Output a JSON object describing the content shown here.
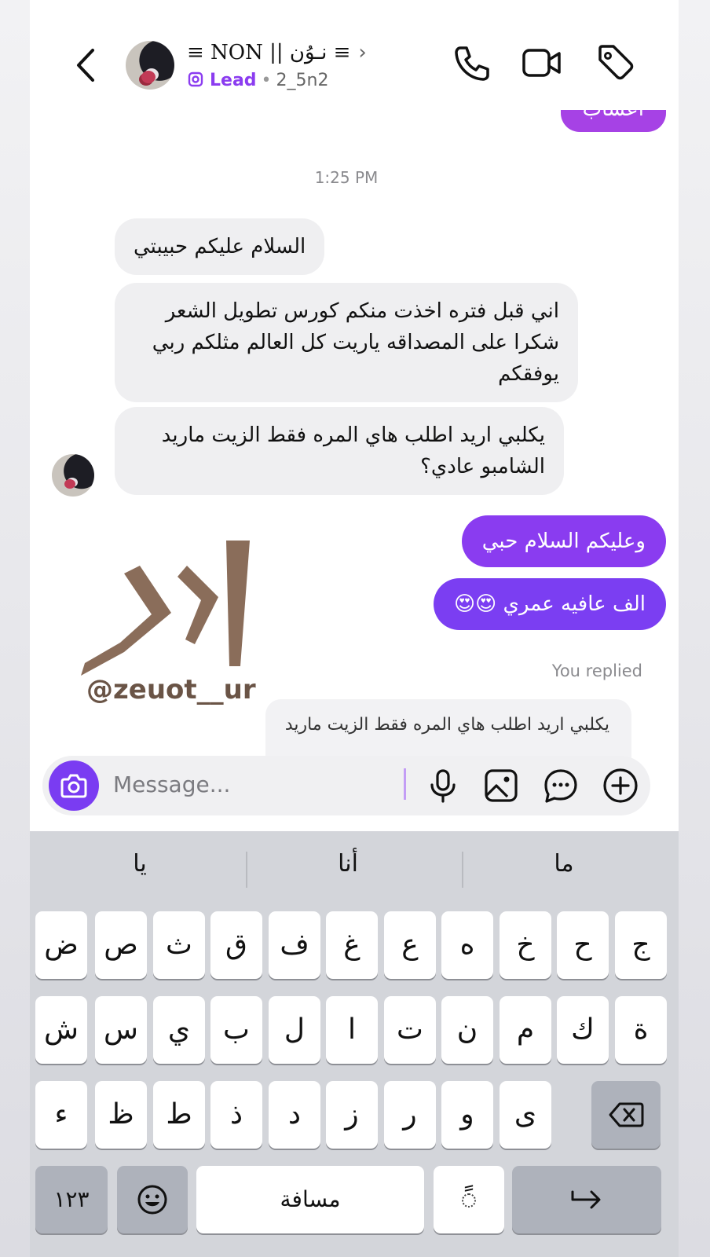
{
  "header": {
    "contact_name": "≡ NON || نـوُن ≡",
    "chevron": "›",
    "lead_label": "Lead",
    "separator": "•",
    "username": "2_5n2"
  },
  "chat": {
    "prev_outgoing_partial": "اعشاب",
    "timestamp": "1:25 PM",
    "incoming": [
      "السلام عليكم حبيبتي",
      "اني قبل فتره اخذت منكم كورس تطويل الشعر شكرا على المصداقه ياريت كل العالم مثلكم ربي يوفقكم",
      "يكلبي اريد اطلب هاي المره فقط الزيت ماريد الشامبو عادي؟"
    ],
    "outgoing": [
      "وعليكم السلام حبي",
      "الف عافيه عمري 😍😍"
    ],
    "replied_label": "You replied",
    "reply_preview": "يكلبي اريد اطلب هاي المره فقط الزيت ماريد",
    "watermark_handle": "@zeuot__ur",
    "colors": {
      "purple_top": "#a642e5",
      "purple_mid": "#8a3cf0",
      "purple_bottom": "#7b3ef2",
      "incoming_bg": "#efeff1"
    }
  },
  "input": {
    "placeholder": "Message..."
  },
  "keyboard": {
    "suggestions": [
      "يا",
      "أنا",
      "ما"
    ],
    "row1": [
      "ض",
      "ص",
      "ث",
      "ق",
      "ف",
      "غ",
      "ع",
      "ه",
      "خ",
      "ح",
      "ج"
    ],
    "row2": [
      "ش",
      "س",
      "ي",
      "ب",
      "ل",
      "ا",
      "ت",
      "ن",
      "م",
      "ك",
      "ة"
    ],
    "row3": [
      "ء",
      "ظ",
      "ط",
      "ذ",
      "د",
      "ز",
      "ر",
      "و",
      "ى"
    ],
    "numbers_label": "١٢٣",
    "space_label": "مسافة",
    "tanween_label": "ً"
  }
}
